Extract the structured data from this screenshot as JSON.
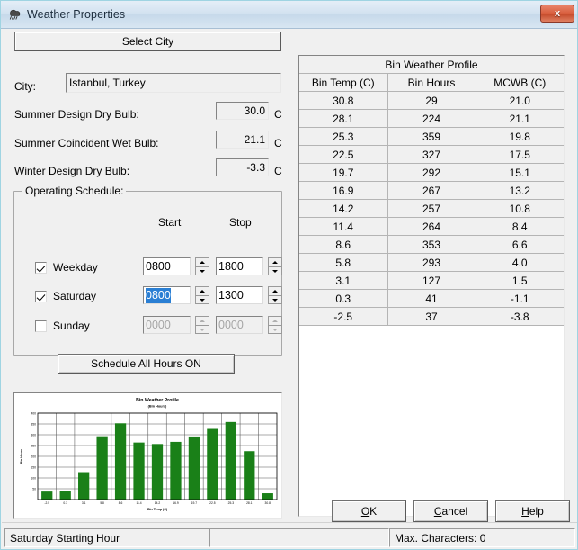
{
  "window": {
    "title": "Weather Properties",
    "icon": "weather-rain-icon",
    "close_label": "x"
  },
  "left_panel": {
    "select_city_button": "Select City",
    "city_label": "City:",
    "city_value": "Istanbul, Turkey",
    "design": [
      {
        "label": "Summer Design Dry Bulb:",
        "value": "30.0",
        "unit": "C"
      },
      {
        "label": "Summer Coincident Wet Bulb:",
        "value": "21.1",
        "unit": "C"
      },
      {
        "label": "Winter Design Dry Bulb:",
        "value": "-3.3",
        "unit": "C"
      }
    ],
    "schedule": {
      "group_title": "Operating Schedule:",
      "start_header": "Start",
      "stop_header": "Stop",
      "rows": [
        {
          "label": "Weekday",
          "checked": true,
          "enabled": true,
          "start": "0800",
          "stop": "1800",
          "start_selected": false
        },
        {
          "label": "Saturday",
          "checked": true,
          "enabled": true,
          "start": "0800",
          "stop": "1300",
          "start_selected": true
        },
        {
          "label": "Sunday",
          "checked": false,
          "enabled": false,
          "start": "0000",
          "stop": "0000",
          "start_selected": false
        }
      ],
      "all_hours_button": "Schedule All Hours ON"
    }
  },
  "grid": {
    "super_header": "Bin Weather Profile",
    "columns": [
      "Bin Temp (C)",
      "Bin Hours",
      "MCWB (C)"
    ],
    "rows": [
      [
        "30.8",
        "29",
        "21.0"
      ],
      [
        "28.1",
        "224",
        "21.1"
      ],
      [
        "25.3",
        "359",
        "19.8"
      ],
      [
        "22.5",
        "327",
        "17.5"
      ],
      [
        "19.7",
        "292",
        "15.1"
      ],
      [
        "16.9",
        "267",
        "13.2"
      ],
      [
        "14.2",
        "257",
        "10.8"
      ],
      [
        "11.4",
        "264",
        "8.4"
      ],
      [
        "8.6",
        "353",
        "6.6"
      ],
      [
        "5.8",
        "293",
        "4.0"
      ],
      [
        "3.1",
        "127",
        "1.5"
      ],
      [
        "0.3",
        "41",
        "-1.1"
      ],
      [
        "-2.5",
        "37",
        "-3.8"
      ]
    ]
  },
  "buttons": {
    "ok": "OK",
    "ok_accel": "O",
    "cancel": "Cancel",
    "cancel_accel": "C",
    "help": "Help",
    "help_accel": "H"
  },
  "statusbar": {
    "left": "Saturday Starting Hour",
    "middle": "",
    "right": "Max. Characters: 0"
  },
  "colors": {
    "bar": "#1a8018",
    "titlebar": "#d3e2f0",
    "close": "#d9603f",
    "selection": "#2a7fd4"
  },
  "chart_data": {
    "type": "bar",
    "title": "Bin Weather Profile",
    "subtitle": "(Bin Hours)",
    "xlabel": "Bin Temp (C)",
    "ylabel": "Bin Hours",
    "categories": [
      "-2.5",
      "0.3",
      "3.1",
      "5.8",
      "8.6",
      "11.4",
      "14.2",
      "16.9",
      "19.7",
      "22.5",
      "25.3",
      "28.1",
      "30.8"
    ],
    "values": [
      37,
      41,
      127,
      293,
      353,
      264,
      257,
      267,
      292,
      327,
      359,
      224,
      29
    ],
    "ylim": [
      0,
      400
    ],
    "yticks": [
      0,
      50,
      100,
      150,
      200,
      250,
      300,
      350,
      400
    ],
    "ytick_labels": [
      "0",
      "50",
      "100",
      "150",
      "200",
      "250",
      "300",
      "350",
      "400"
    ],
    "grid": true,
    "legend": false,
    "bar_color": "#1a8018"
  }
}
